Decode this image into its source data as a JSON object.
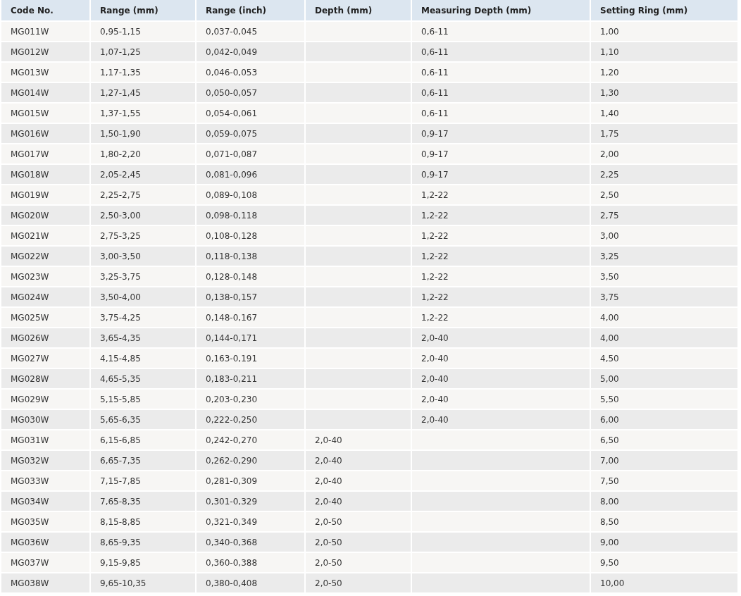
{
  "table": {
    "columns": [
      "Code No.",
      "Range (mm)",
      "Range (inch)",
      "Depth (mm)",
      "Measuring Depth (mm)",
      "Setting Ring (mm)"
    ],
    "rows": [
      {
        "code": "MG011W",
        "range_mm": "0,95-1,15",
        "range_inch": "0,037-0,045",
        "measuring_depth": "0,6-11",
        "setting_ring": "1,00"
      },
      {
        "code": "MG012W",
        "range_mm": "1,07-1,25",
        "range_inch": "0,042-0,049",
        "measuring_depth": "0,6-11",
        "setting_ring": "1,10"
      },
      {
        "code": "MG013W",
        "range_mm": "1,17-1,35",
        "range_inch": "0,046-0,053",
        "measuring_depth": "0,6-11",
        "setting_ring": "1,20"
      },
      {
        "code": "MG014W",
        "range_mm": "1,27-1,45",
        "range_inch": "0,050-0,057",
        "measuring_depth": "0,6-11",
        "setting_ring": "1,30"
      },
      {
        "code": "MG015W",
        "range_mm": "1,37-1,55",
        "range_inch": "0,054-0,061",
        "measuring_depth": "0,6-11",
        "setting_ring": "1,40"
      },
      {
        "code": "MG016W",
        "range_mm": "1,50-1,90",
        "range_inch": "0,059-0,075",
        "measuring_depth": "0,9-17",
        "setting_ring": "1,75"
      },
      {
        "code": "MG017W",
        "range_mm": "1,80-2,20",
        "range_inch": "0,071-0,087",
        "measuring_depth": "0,9-17",
        "setting_ring": "2,00"
      },
      {
        "code": "MG018W",
        "range_mm": "2,05-2,45",
        "range_inch": "0,081-0,096",
        "measuring_depth": "0,9-17",
        "setting_ring": "2,25"
      },
      {
        "code": "MG019W",
        "range_mm": "2,25-2,75",
        "range_inch": "0,089-0,108",
        "measuring_depth": "1,2-22",
        "setting_ring": "2,50"
      },
      {
        "code": "MG020W",
        "range_mm": "2,50-3,00",
        "range_inch": "0,098-0,118",
        "measuring_depth": "1,2-22",
        "setting_ring": "2,75"
      },
      {
        "code": "MG021W",
        "range_mm": "2,75-3,25",
        "range_inch": "0,108-0,128",
        "measuring_depth": "1,2-22",
        "setting_ring": "3,00"
      },
      {
        "code": "MG022W",
        "range_mm": "3,00-3,50",
        "range_inch": "0,118-0,138",
        "measuring_depth": "1,2-22",
        "setting_ring": "3,25"
      },
      {
        "code": "MG023W",
        "range_mm": "3,25-3,75",
        "range_inch": "0,128-0,148",
        "measuring_depth": "1,2-22",
        "setting_ring": "3,50"
      },
      {
        "code": "MG024W",
        "range_mm": "3,50-4,00",
        "range_inch": "0,138-0,157",
        "measuring_depth": "1,2-22",
        "setting_ring": "3,75"
      },
      {
        "code": "MG025W",
        "range_mm": "3,75-4,25",
        "range_inch": "0,148-0,167",
        "measuring_depth": "1,2-22",
        "setting_ring": "4,00"
      },
      {
        "code": "MG026W",
        "range_mm": "3,65-4,35",
        "range_inch": "0,144-0,171",
        "measuring_depth": "2,0-40",
        "setting_ring": "4,00"
      },
      {
        "code": "MG027W",
        "range_mm": "4,15-4,85",
        "range_inch": "0,163-0,191",
        "measuring_depth": "2,0-40",
        "setting_ring": "4,50"
      },
      {
        "code": "MG028W",
        "range_mm": "4,65-5,35",
        "range_inch": "0,183-0,211",
        "measuring_depth": "2,0-40",
        "setting_ring": "5,00"
      },
      {
        "code": "MG029W",
        "range_mm": "5,15-5,85",
        "range_inch": "0,203-0,230",
        "measuring_depth": "2,0-40",
        "setting_ring": "5,50"
      },
      {
        "code": "MG030W",
        "range_mm": "5,65-6,35",
        "range_inch": "0,222-0,250",
        "measuring_depth": "2,0-40",
        "setting_ring": "6,00"
      },
      {
        "code": "MG031W",
        "range_mm": "6,15-6,85",
        "range_inch": "0,242-0,270",
        "depth": "2,0-40",
        "setting_ring": "6,50"
      },
      {
        "code": "MG032W",
        "range_mm": "6,65-7,35",
        "range_inch": "0,262-0,290",
        "depth": "2,0-40",
        "setting_ring": "7,00"
      },
      {
        "code": "MG033W",
        "range_mm": "7,15-7,85",
        "range_inch": "0,281-0,309",
        "depth": "2,0-40",
        "setting_ring": "7,50"
      },
      {
        "code": "MG034W",
        "range_mm": "7,65-8,35",
        "range_inch": "0,301-0,329",
        "depth": "2,0-40",
        "setting_ring": "8,00"
      },
      {
        "code": "MG035W",
        "range_mm": "8,15-8,85",
        "range_inch": "0,321-0,349",
        "depth": "2,0-50",
        "setting_ring": "8,50"
      },
      {
        "code": "MG036W",
        "range_mm": "8,65-9,35",
        "range_inch": "0,340-0,368",
        "depth": "2,0-50",
        "setting_ring": "9,00"
      },
      {
        "code": "MG037W",
        "range_mm": "9,15-9,85",
        "range_inch": "0,360-0,388",
        "depth": "2,0-50",
        "setting_ring": "9,50"
      },
      {
        "code": "MG038W",
        "range_mm": "9,65-10,35",
        "range_inch": "0,380-0,408",
        "depth": "2,0-50",
        "setting_ring": "10,00"
      }
    ]
  }
}
